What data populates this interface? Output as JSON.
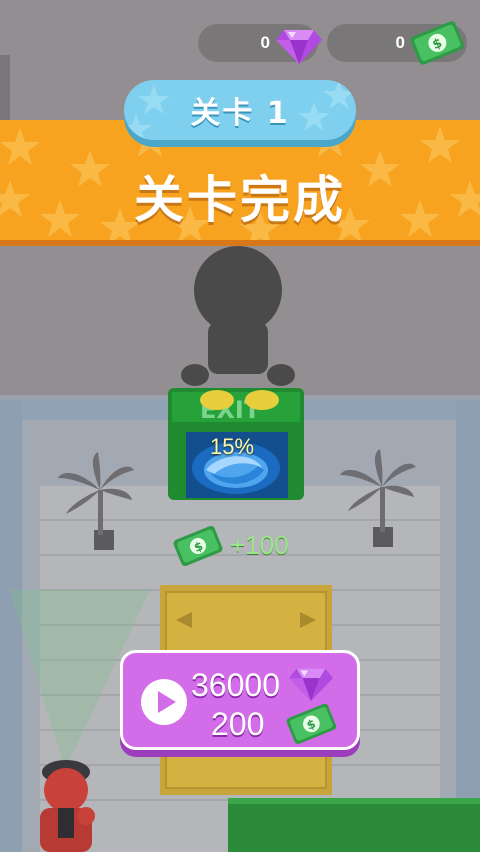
{
  "hud": {
    "gems": "0",
    "cash": "0"
  },
  "level": {
    "label": "关卡 1"
  },
  "banner": {
    "title": "关卡完成"
  },
  "portal": {
    "progress_text": "15%",
    "progress_fraction": 0.15
  },
  "reward_popup": {
    "text": "+100"
  },
  "reward_button": {
    "gem_amount": "36000",
    "cash_amount": "200"
  },
  "colors": {
    "banner_orange": "#f7a320",
    "level_pill_blue": "#7fd0ee",
    "reward_button_purple": "#d36ce9",
    "portal_green": "#27a23a",
    "cash_green": "#3fbf5a",
    "gem_purple": "#b04ae0"
  },
  "icons": [
    "gem-icon",
    "cash-icon",
    "play-icon",
    "star-icon"
  ]
}
